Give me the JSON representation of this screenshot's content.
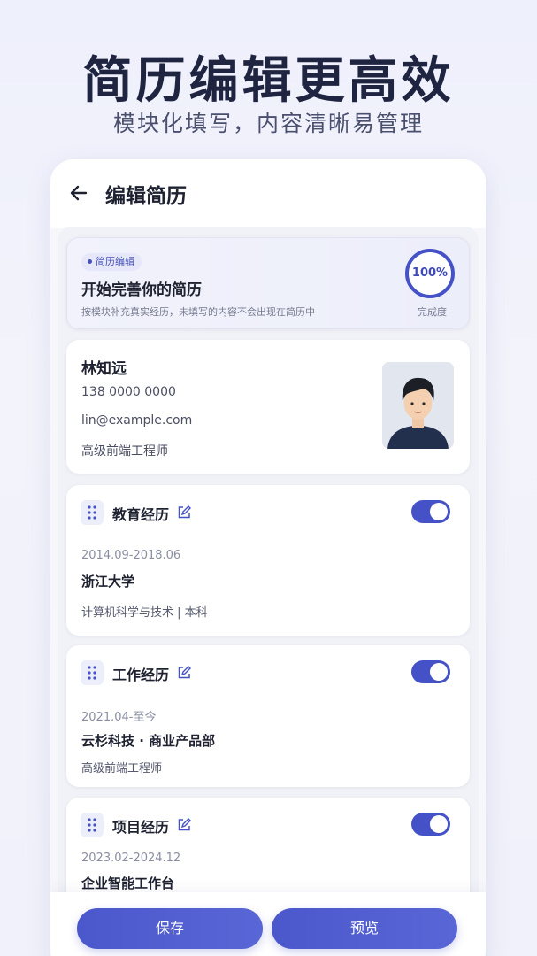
{
  "hero": {
    "title": "简历编辑更高效",
    "subtitle": "模块化填写，内容清晰易管理"
  },
  "topbar": {
    "title": "编辑简历"
  },
  "intro": {
    "tag": "简历编辑",
    "title": "开始完善你的简历",
    "desc": "按模块补充真实经历，未填写的内容不会出现在简历中",
    "progress_value": "100%",
    "progress_fraction": 1.0,
    "progress_label": "完成度"
  },
  "profile": {
    "name": "林知远",
    "phone": "138 0000 0000",
    "email": "lin@example.com",
    "role": "高级前端工程师"
  },
  "sections": {
    "education": {
      "title": "教育经历",
      "enabled": true,
      "date": "2014.09-2018.06",
      "org": "浙江大学",
      "meta": "计算机科学与技术 | 本科"
    },
    "work": {
      "title": "工作经历",
      "enabled": true,
      "date": "2021.04-至今",
      "org": "云杉科技 · 商业产品部",
      "meta": "高级前端工程师"
    },
    "project": {
      "title": "项目经历",
      "enabled": true,
      "date": "2023.02-2024.12",
      "org": "企业智能工作台"
    }
  },
  "footer": {
    "save_label": "保存",
    "preview_label": "预览"
  },
  "colors": {
    "accent": "#4552c7",
    "title": "#1f2440"
  }
}
